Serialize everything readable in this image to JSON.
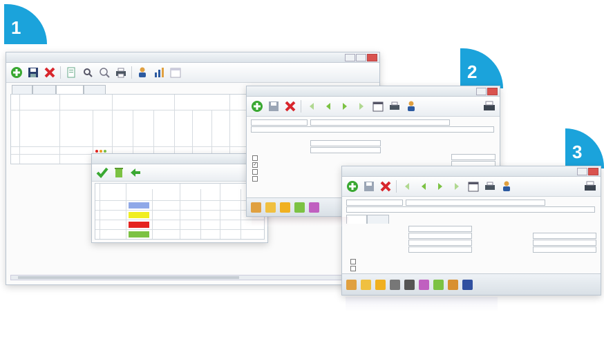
{
  "badges": [
    "1",
    "2",
    "3"
  ],
  "colors": {
    "badge": "#1ba3db",
    "blue_swatch": "#8fa8e8",
    "yellow_swatch": "#f0ee22",
    "red_swatch": "#e5231e",
    "green_swatch": "#7cc243"
  },
  "icons": {
    "toolbar_main": [
      "add-icon",
      "save-icon",
      "delete-icon",
      "document-icon",
      "search-icon",
      "zoom-icon",
      "printer-icon",
      "user-icon",
      "chart-icon",
      "calendar-icon"
    ],
    "toolbar_dialog": [
      "add-icon",
      "save-icon",
      "delete-icon",
      "first-icon",
      "prev-icon",
      "next-icon",
      "last-icon",
      "calendar-icon",
      "printer-icon",
      "user-icon"
    ],
    "popup": [
      "check-icon",
      "delete-icon",
      "back-arrow-icon"
    ],
    "bottom_bar": [
      "users-icon",
      "tools-icon",
      "pencil-icon",
      "eraser-icon",
      "network-icon",
      "box-icon",
      "archive-icon"
    ]
  }
}
